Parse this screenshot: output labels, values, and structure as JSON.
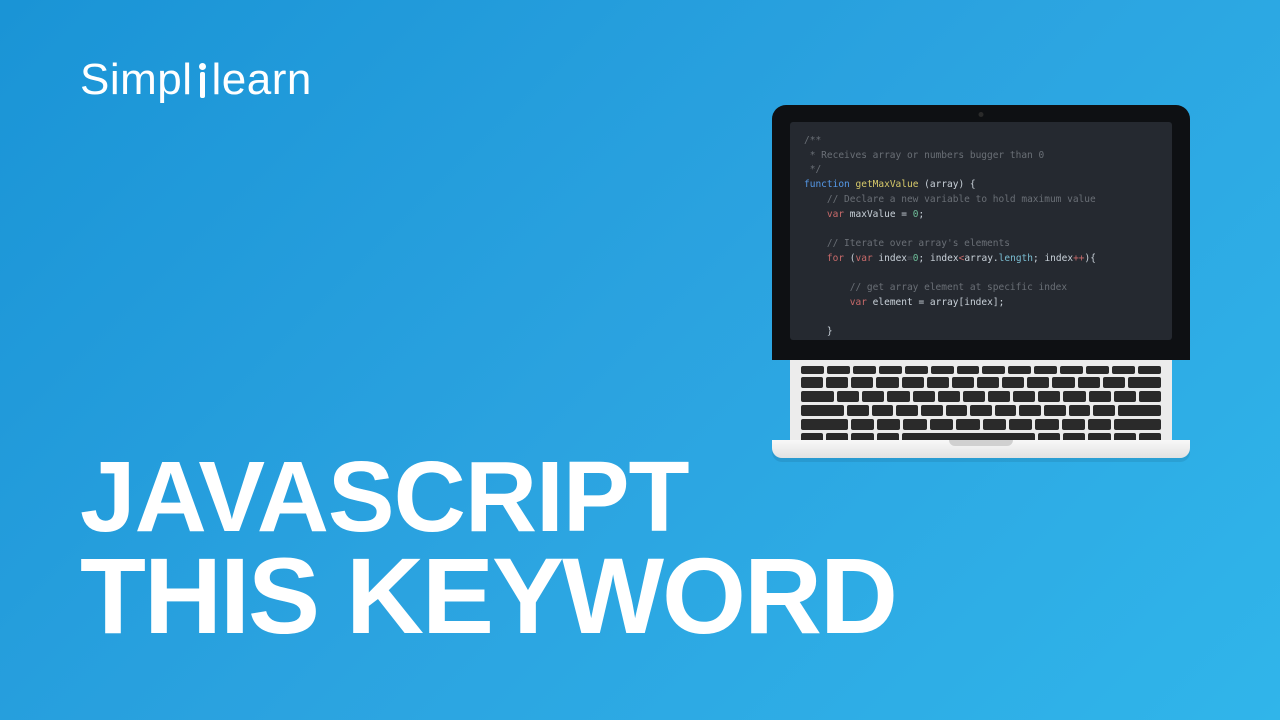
{
  "brand": {
    "part1": "Simpl",
    "part2": "learn"
  },
  "title": {
    "line1": "JAVASCRIPT",
    "line2": "THIS KEYWORD"
  },
  "code": {
    "c1": "/**",
    "c2": " * Receives array or numbers bugger than 0",
    "c3": " */",
    "fn_kw": "function",
    "fn_name": "getMaxValue",
    "fn_args": "(array)",
    "brace_open": " {",
    "c4": "// Declare a new variable to hold maximum value",
    "var_kw": "var",
    "mv": "maxValue",
    "eq0": " = ",
    "zero": "0",
    "semi": ";",
    "c5": "// Iterate over array's elements",
    "for_kw": "for",
    "for_open": " (",
    "idx": "index",
    "lt": "<",
    "arr": "array",
    "dot": ".",
    "len": "length",
    "pp": "++",
    "for_close": "){",
    "c6": "// get array element at specific index",
    "elem": "element",
    "eq": " = ",
    "bo": "[",
    "bc": "]",
    "brace_close": "}"
  }
}
